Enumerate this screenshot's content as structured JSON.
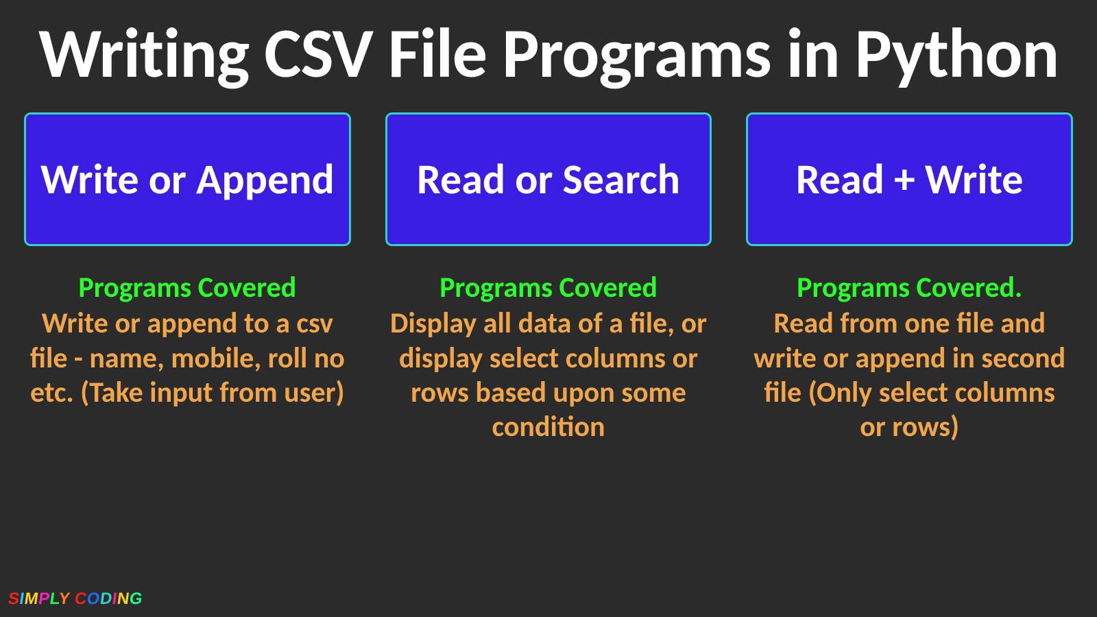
{
  "title": "Writing CSV File Programs in Python",
  "columns": [
    {
      "card_label": "Write or Append",
      "programs_heading": "Programs Covered",
      "description": "Write or append to a csv file  - name, mobile, roll no etc. (Take input from user)"
    },
    {
      "card_label": "Read or Search",
      "programs_heading": "Programs Covered",
      "description": "Display all data of a file, or display select columns or rows based upon some condition"
    },
    {
      "card_label": "Read + Write",
      "programs_heading": "Programs Covered.",
      "description": "Read from one file and write or append in second file (Only select columns or rows)"
    }
  ],
  "logo": {
    "word1": "SIMPLY",
    "word2": "CODING"
  }
}
